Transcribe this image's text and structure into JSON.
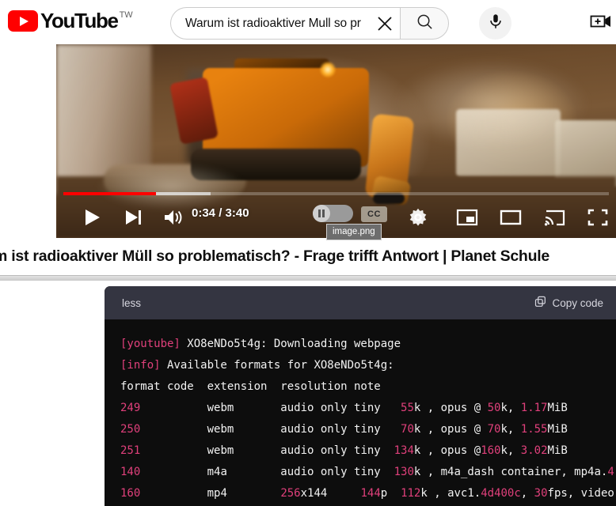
{
  "header": {
    "logo_text": "YouTube",
    "country_code": "TW",
    "logo_icon": "youtube-play-icon",
    "search": {
      "value": "Warum ist radioaktiver Mull so pr",
      "placeholder": "Search",
      "clear_icon": "close-x-icon",
      "search_icon": "search-magnifier-icon"
    },
    "mic_icon": "microphone-icon",
    "create_icon": "create-video-camera-plus-icon"
  },
  "player": {
    "current_time": "0:34",
    "duration": "3:40",
    "time_display": "0:34 / 3:40",
    "progress_played_percent": 17,
    "progress_buffered_percent": 27,
    "controls": {
      "play_icon": "play-triangle-icon",
      "next_icon": "next-track-icon",
      "volume_icon": "volume-speaker-icon",
      "autoplay_icon": "autoplay-toggle-paused-icon",
      "cc_label": "CC",
      "settings_icon": "gear-settings-icon",
      "miniplayer_icon": "miniplayer-icon",
      "theater_icon": "theater-mode-icon",
      "cast_icon": "cast-to-tv-icon",
      "fullscreen_icon": "fullscreen-icon"
    },
    "tooltip": "image.png"
  },
  "video_title": "m ist radioaktiver Müll so problematisch? - Frage trifft Antwort | Planet Schule",
  "code_block": {
    "language": "less",
    "copy_label": "Copy code",
    "copy_icon": "copy-duplicate-icon",
    "lines": [
      [
        {
          "t": "[youtube]",
          "c": "pink"
        },
        {
          "t": " XO8eNDo5t4g: Downloading webpage",
          "c": "white"
        }
      ],
      [
        {
          "t": "[info]",
          "c": "pink"
        },
        {
          "t": " Available formats for XO8eNDo5t4g:",
          "c": "white"
        }
      ],
      [
        {
          "t": "format code  extension  resolution note",
          "c": "white"
        }
      ],
      [
        {
          "t": "249",
          "c": "pink"
        },
        {
          "t": "          webm       audio only tiny   ",
          "c": "white"
        },
        {
          "t": "55",
          "c": "pink"
        },
        {
          "t": "k , opus @ ",
          "c": "white"
        },
        {
          "t": "50",
          "c": "pink"
        },
        {
          "t": "k, ",
          "c": "white"
        },
        {
          "t": "1.17",
          "c": "pink"
        },
        {
          "t": "MiB",
          "c": "white"
        }
      ],
      [
        {
          "t": "250",
          "c": "pink"
        },
        {
          "t": "          webm       audio only tiny   ",
          "c": "white"
        },
        {
          "t": "70",
          "c": "pink"
        },
        {
          "t": "k , opus @ ",
          "c": "white"
        },
        {
          "t": "70",
          "c": "pink"
        },
        {
          "t": "k, ",
          "c": "white"
        },
        {
          "t": "1.55",
          "c": "pink"
        },
        {
          "t": "MiB",
          "c": "white"
        }
      ],
      [
        {
          "t": "251",
          "c": "pink"
        },
        {
          "t": "          webm       audio only tiny  ",
          "c": "white"
        },
        {
          "t": "134",
          "c": "pink"
        },
        {
          "t": "k , opus @",
          "c": "white"
        },
        {
          "t": "160",
          "c": "pink"
        },
        {
          "t": "k, ",
          "c": "white"
        },
        {
          "t": "3.02",
          "c": "pink"
        },
        {
          "t": "MiB",
          "c": "white"
        }
      ],
      [
        {
          "t": "140",
          "c": "pink"
        },
        {
          "t": "          m4a        audio only tiny  ",
          "c": "white"
        },
        {
          "t": "130",
          "c": "pink"
        },
        {
          "t": "k , m4a_dash container, mp4a.",
          "c": "white"
        },
        {
          "t": "4",
          "c": "pink"
        }
      ],
      [
        {
          "t": "160",
          "c": "pink"
        },
        {
          "t": "          mp4        ",
          "c": "white"
        },
        {
          "t": "256",
          "c": "pink"
        },
        {
          "t": "x144",
          "c": "white"
        },
        {
          "t": "     144",
          "c": "pink"
        },
        {
          "t": "p  ",
          "c": "white"
        },
        {
          "t": "112",
          "c": "pink"
        },
        {
          "t": "k , avc1.",
          "c": "white"
        },
        {
          "t": "4d400c",
          "c": "pink"
        },
        {
          "t": ", ",
          "c": "white"
        },
        {
          "t": "30",
          "c": "pink"
        },
        {
          "t": "fps, video",
          "c": "white"
        }
      ]
    ]
  },
  "colors": {
    "youtube_red": "#ff0000",
    "code_bg": "#0d0d0d",
    "code_header_bg": "#343541",
    "token_pink": "#e0407b",
    "token_white": "#f2f2f2"
  }
}
